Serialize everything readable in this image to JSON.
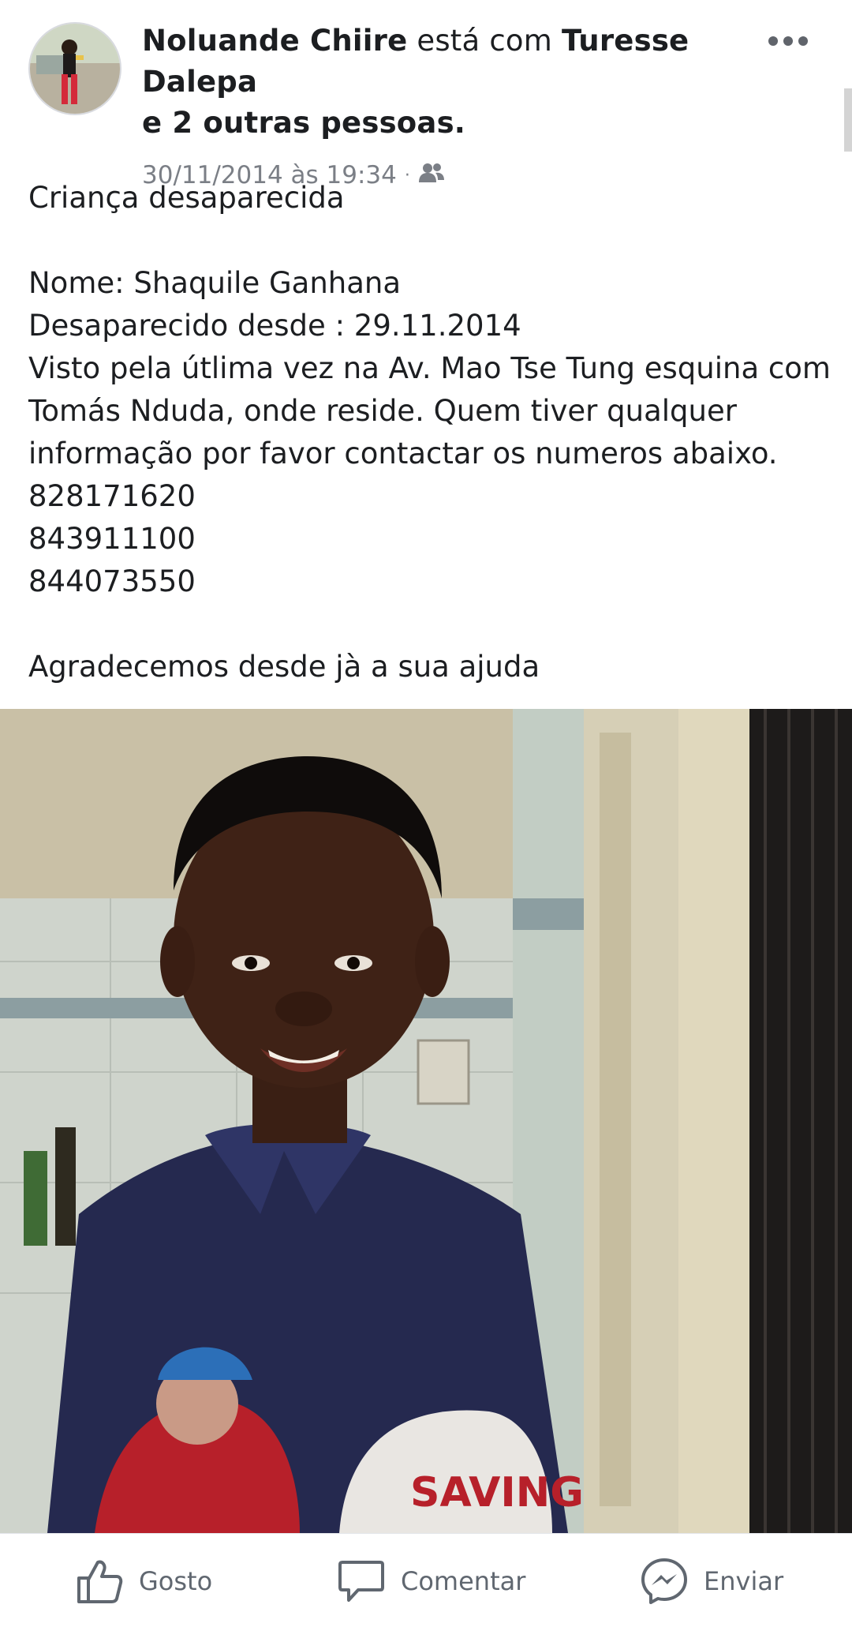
{
  "post": {
    "author": "Noluande Chiire",
    "connector": "está com",
    "tagged": "Turesse Dalepa",
    "others": "e 2 outras pessoas.",
    "timestamp": "30/11/2014 às 19:34",
    "separator": "·",
    "audience_icon": "friends-icon"
  },
  "body": {
    "heading": "Criança desaparecida",
    "name_line": "Nome: Shaquile Ganhana",
    "since_line": "Desaparecido desde : 29.11.2014",
    "seen_line_1": "Visto pela útlima vez na Av. Mao Tse Tung esquina com",
    "seen_line_2": "Tomás Nduda, onde reside. Quem tiver qualquer",
    "seen_line_3": "informação por favor contactar os numeros abaixo.",
    "phones": [
      "828171620",
      "843911100",
      "844073550"
    ],
    "closing": "Agradecemos desde jà a sua ajuda"
  },
  "actions": {
    "like": "Gosto",
    "comment": "Comentar",
    "send": "Enviar"
  },
  "colors": {
    "text": "#1c1e21",
    "meta": "#7b7f86",
    "action": "#606770"
  }
}
